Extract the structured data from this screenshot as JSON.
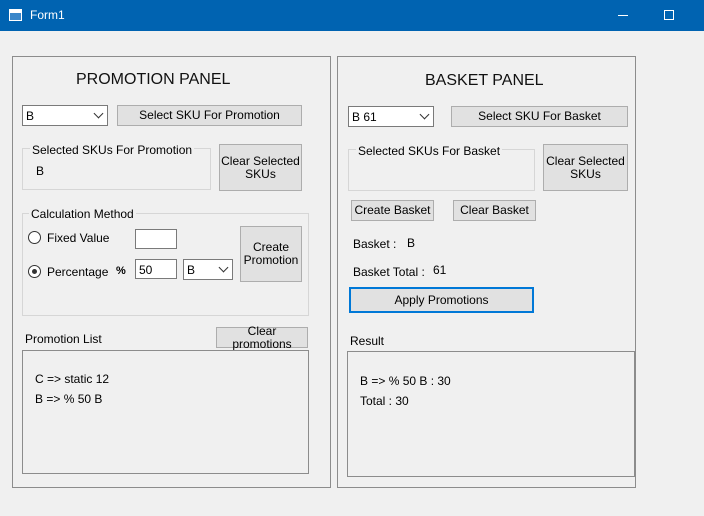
{
  "window": {
    "title": "Form1"
  },
  "promotion_panel": {
    "title": "PROMOTION PANEL",
    "sku_combo_value": "B",
    "select_sku_button": "Select SKU For Promotion",
    "selected_skus_label": "Selected SKUs For Promotion",
    "selected_skus_value": "B",
    "clear_selected_button": "Clear Selected SKUs",
    "calculation": {
      "legend": "Calculation Method",
      "fixed_label": "Fixed Value",
      "fixed_value": "",
      "percentage_label": "Percentage",
      "percent_symbol": "%",
      "percentage_value": "50",
      "percentage_sku": "B",
      "selected_method": "Percentage"
    },
    "create_promotion_button": "Create Promotion",
    "promotion_list_label": "Promotion List",
    "clear_promotions_button": "Clear promotions",
    "promotion_list": [
      "C => static 12",
      "B => % 50 B"
    ]
  },
  "basket_panel": {
    "title": "BASKET PANEL",
    "sku_combo_value": "B 61",
    "select_sku_button": "Select SKU For Basket",
    "selected_skus_label": "Selected SKUs For Basket",
    "clear_selected_button": "Clear Selected SKUs",
    "create_basket_button": "Create Basket",
    "clear_basket_button": "Clear Basket",
    "basket_label": "Basket :",
    "basket_value": "B",
    "basket_total_label": "Basket Total :",
    "basket_total_value": "61",
    "apply_promotions_button": "Apply Promotions",
    "result_label": "Result",
    "result_lines": [
      "B => % 50 B : 30",
      "Total : 30"
    ]
  }
}
